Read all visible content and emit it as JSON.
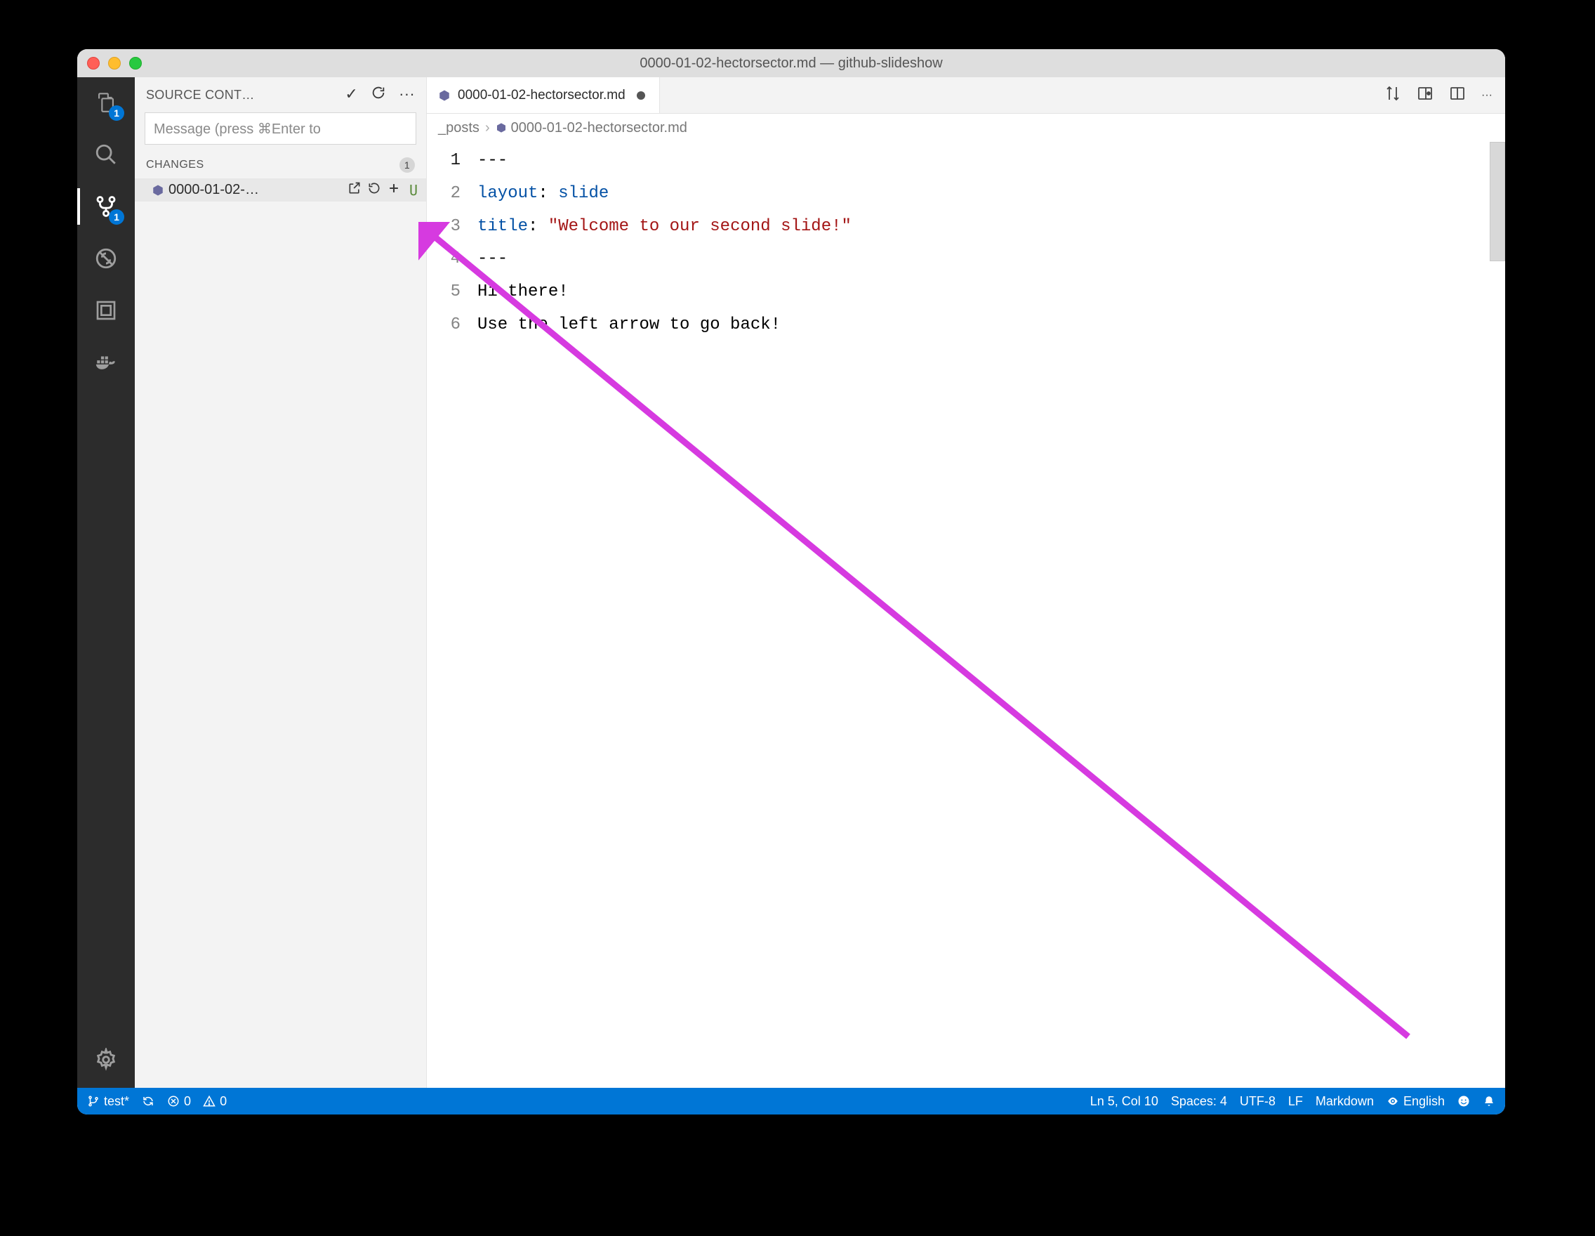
{
  "window": {
    "title": "0000-01-02-hectorsector.md — github-slideshow"
  },
  "activitybar": {
    "explorer_badge": "1",
    "scm_badge": "1"
  },
  "scm": {
    "header": "SOURCE CONT…",
    "message_placeholder": "Message (press ⌘Enter to",
    "changes_label": "CHANGES",
    "changes_count": "1",
    "items": [
      {
        "name": "0000-01-02-…",
        "status": "U"
      }
    ]
  },
  "tabs": [
    {
      "label": "0000-01-02-hectorsector.md",
      "modified": true
    }
  ],
  "breadcrumbs": {
    "folder": "_posts",
    "file": "0000-01-02-hectorsector.md"
  },
  "code": {
    "lines": [
      {
        "n": "1",
        "segments": [
          {
            "cls": "tok-dash",
            "t": "---"
          }
        ]
      },
      {
        "n": "2",
        "segments": [
          {
            "cls": "tok-key",
            "t": "layout"
          },
          {
            "cls": "tok-plain",
            "t": ": "
          },
          {
            "cls": "tok-val",
            "t": "slide"
          }
        ]
      },
      {
        "n": "3",
        "segments": [
          {
            "cls": "tok-key",
            "t": "title"
          },
          {
            "cls": "tok-plain",
            "t": ": "
          },
          {
            "cls": "tok-str",
            "t": "\"Welcome to our second slide!\""
          }
        ]
      },
      {
        "n": "4",
        "segments": [
          {
            "cls": "tok-dash",
            "t": "---"
          }
        ]
      },
      {
        "n": "5",
        "segments": [
          {
            "cls": "tok-plain",
            "t": "Hi there!"
          }
        ]
      },
      {
        "n": "6",
        "segments": [
          {
            "cls": "tok-plain",
            "t": "Use the left arrow to go back!"
          }
        ]
      }
    ]
  },
  "statusbar": {
    "branch": "test*",
    "errors": "0",
    "warnings": "0",
    "cursor": "Ln 5, Col 10",
    "spaces": "Spaces: 4",
    "encoding": "UTF-8",
    "eol": "LF",
    "language": "Markdown",
    "lang_status": "English"
  },
  "colors": {
    "accent": "#0076d6",
    "arrow": "#d63ae0"
  }
}
